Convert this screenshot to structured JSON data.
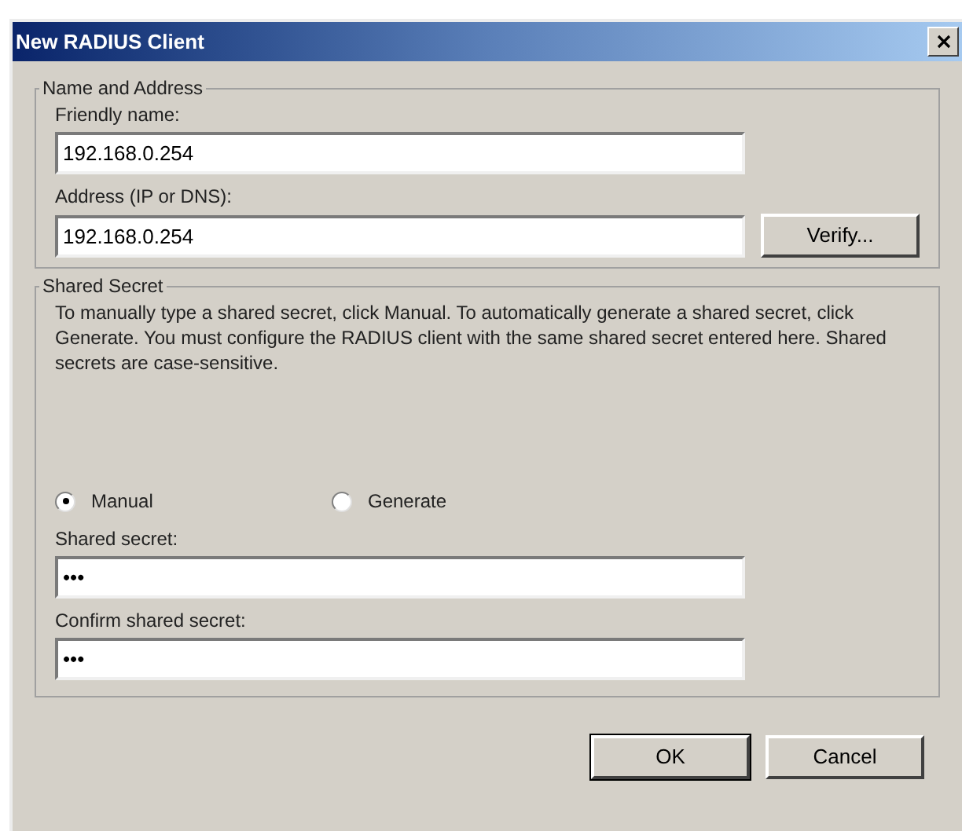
{
  "window": {
    "title": "New RADIUS Client"
  },
  "name_and_address": {
    "title": "Name and Address",
    "fields": [
      {
        "label": "Friendly name:",
        "value": "192.168.0.254"
      },
      {
        "label": "Address (IP or DNS):",
        "value": "192.168.0.254",
        "button": {
          "label": "Verify..."
        }
      }
    ]
  },
  "shared_secret": {
    "title": "Shared Secret",
    "description": "To manually type a shared secret, click Manual. To automatically generate a shared secret, click Generate. You must configure the RADIUS client with the same shared secret entered here. Shared secrets are case-sensitive.",
    "options": [
      {
        "label": "Manual",
        "selected": true
      },
      {
        "label": "Generate",
        "selected": false
      }
    ],
    "fields": [
      {
        "label": "Shared secret:",
        "value": "•••"
      },
      {
        "label": "Confirm shared secret:",
        "value": "•••"
      }
    ]
  },
  "buttons": [
    {
      "label": "OK",
      "default": true
    },
    {
      "label": "Cancel",
      "default": false
    }
  ]
}
